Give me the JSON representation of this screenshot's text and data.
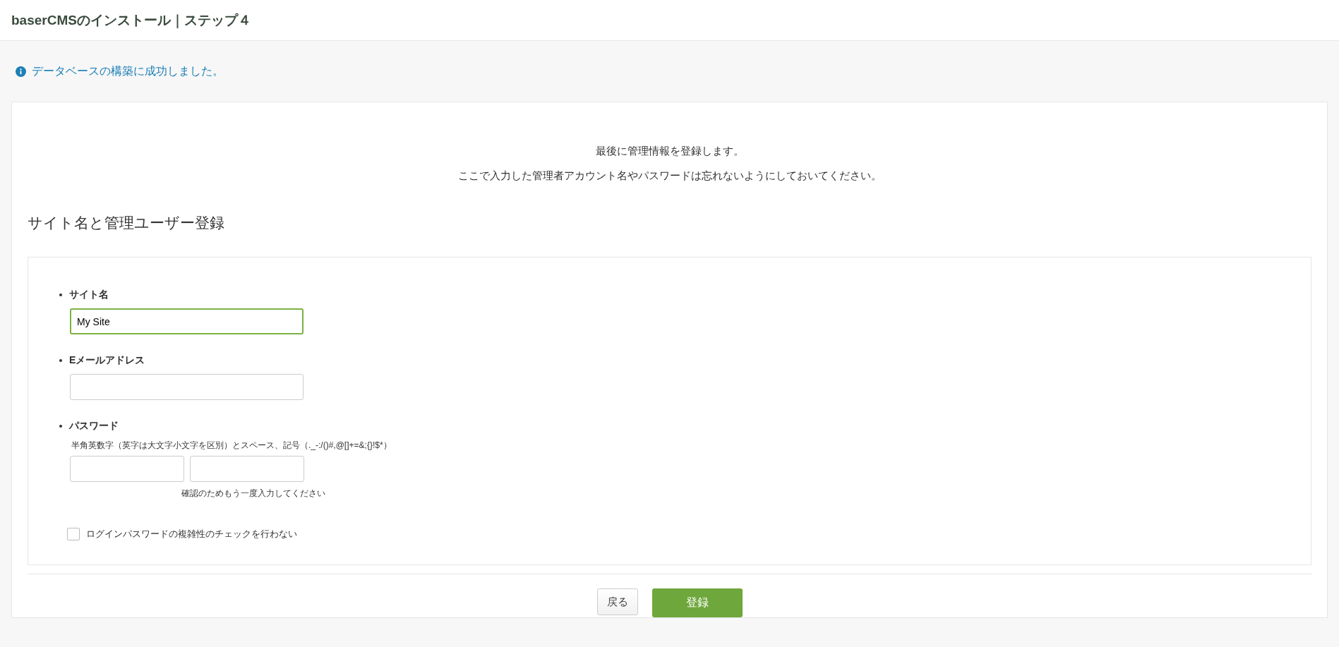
{
  "header": {
    "title": "baserCMSのインストール｜ステップ４"
  },
  "message": {
    "text": "データベースの構築に成功しました。"
  },
  "intro": [
    "最後に管理情報を登録します。",
    "ここで入力した管理者アカウント名やパスワードは忘れないようにしておいてください。"
  ],
  "section_title": "サイト名と管理ユーザー登録",
  "fields": [
    {
      "kind": "text",
      "label": "サイト名",
      "value": "My Site",
      "focused": true
    },
    {
      "kind": "text",
      "label": "Eメールアドレス",
      "focused": false
    },
    {
      "kind": "password",
      "label": "パスワード",
      "hint": "半角英数字（英字は大文字小文字を区別）とスペース、記号（._-:/()#,@[]+=&;{}!$*）",
      "confirm_hint": "確認のためもう一度入力してください",
      "focused": false
    }
  ],
  "checkbox": {
    "label": "ログインパスワードの複雑性のチェックを行わない",
    "checked": false
  },
  "buttons": [
    {
      "kind": "secondary",
      "label": "戻る"
    },
    {
      "kind": "primary",
      "label": "登録"
    }
  ]
}
